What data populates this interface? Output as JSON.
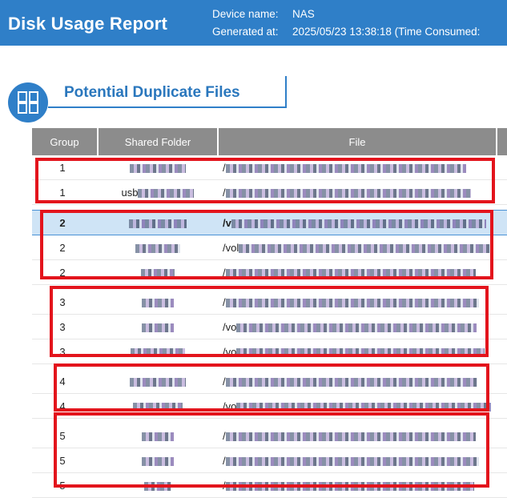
{
  "header": {
    "title": "Disk Usage Report",
    "device_label": "Device name:",
    "device_value": "NAS",
    "generated_label": "Generated at:",
    "generated_value": "2025/05/23 13:38:18 (Time Consumed:"
  },
  "section": {
    "title": "Potential Duplicate Files",
    "icon": "duplicate-files-icon"
  },
  "table": {
    "columns": [
      "Group",
      "Shared Folder",
      "File"
    ],
    "rows": [
      {
        "group": "1",
        "folder_prefix": "",
        "file_prefix": "/",
        "selected": false
      },
      {
        "group": "1",
        "folder_prefix": "usb",
        "file_prefix": "/",
        "selected": false
      },
      {
        "group": "2",
        "folder_prefix": "",
        "file_prefix": "/v",
        "selected": true
      },
      {
        "group": "2",
        "folder_prefix": "",
        "file_prefix": "/vol",
        "selected": false
      },
      {
        "group": "2",
        "folder_prefix": "",
        "file_prefix": "/",
        "selected": false
      },
      {
        "group": "3",
        "folder_prefix": "",
        "file_prefix": "/",
        "selected": false
      },
      {
        "group": "3",
        "folder_prefix": "",
        "file_prefix": "/vo",
        "selected": false
      },
      {
        "group": "3",
        "folder_prefix": "",
        "file_prefix": "/vo",
        "selected": false
      },
      {
        "group": "4",
        "folder_prefix": "",
        "file_prefix": "/",
        "selected": false
      },
      {
        "group": "4",
        "folder_prefix": "",
        "file_prefix": "/vo",
        "selected": false
      },
      {
        "group": "5",
        "folder_prefix": "",
        "file_prefix": "/",
        "selected": false
      },
      {
        "group": "5",
        "folder_prefix": "",
        "file_prefix": "/",
        "selected": false
      },
      {
        "group": "5",
        "folder_prefix": "",
        "file_prefix": "/",
        "selected": false
      }
    ]
  },
  "colors": {
    "header_bg": "#2f7fc8",
    "table_header_bg": "#8c8c8c",
    "selected_row_bg": "#cfe4f6",
    "highlight_border": "#e3141c",
    "section_title": "#2a77bd"
  }
}
